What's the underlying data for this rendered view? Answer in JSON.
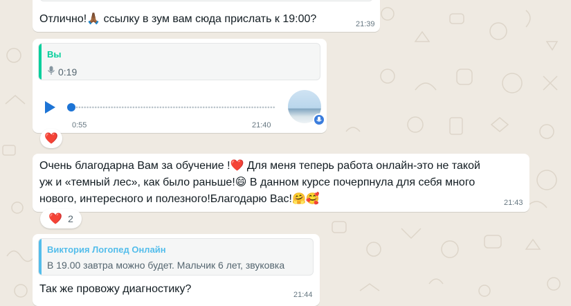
{
  "messages": [
    {
      "text": "Отлично!🙏🏾 ссылку в зум вам сюда прислать к 19:00?",
      "time": "21:39"
    },
    {
      "quote": {
        "author": "Вы",
        "duration": "0:19"
      },
      "voice": {
        "played": "0:55",
        "time": "21:40",
        "progress": 0.0
      },
      "reaction": "❤️"
    },
    {
      "lines": [
        "Очень благодарна Вам за обучение !❤️ Для меня теперь работа онлайн-это не такой",
        "уж и «темный лес», как было раньше!😄 В данном курсе почерпнула для себя много",
        "нового, интересного и полезного!Благодарю Вас!🤗🥰"
      ],
      "time": "21:43",
      "reaction": {
        "emoji": "❤️",
        "count": "2"
      }
    },
    {
      "quote": {
        "author": "Виктория Логопед Онлайн",
        "text": "В 19.00 завтра можно будет.  Мальчик 6 лет, звуковка"
      },
      "text": "Так же провожу диагностику?",
      "time": "21:44"
    }
  ],
  "colors": {
    "background": "#efeae2",
    "bubble": "#ffffff",
    "you_accent": "#06cf9c",
    "author_accent": "#53bdeb",
    "play_button": "#1daa61",
    "mic_badge": "#3b7ddd"
  },
  "icons": [
    "mic-icon",
    "play-icon",
    "heart-icon",
    "avatar-image"
  ]
}
